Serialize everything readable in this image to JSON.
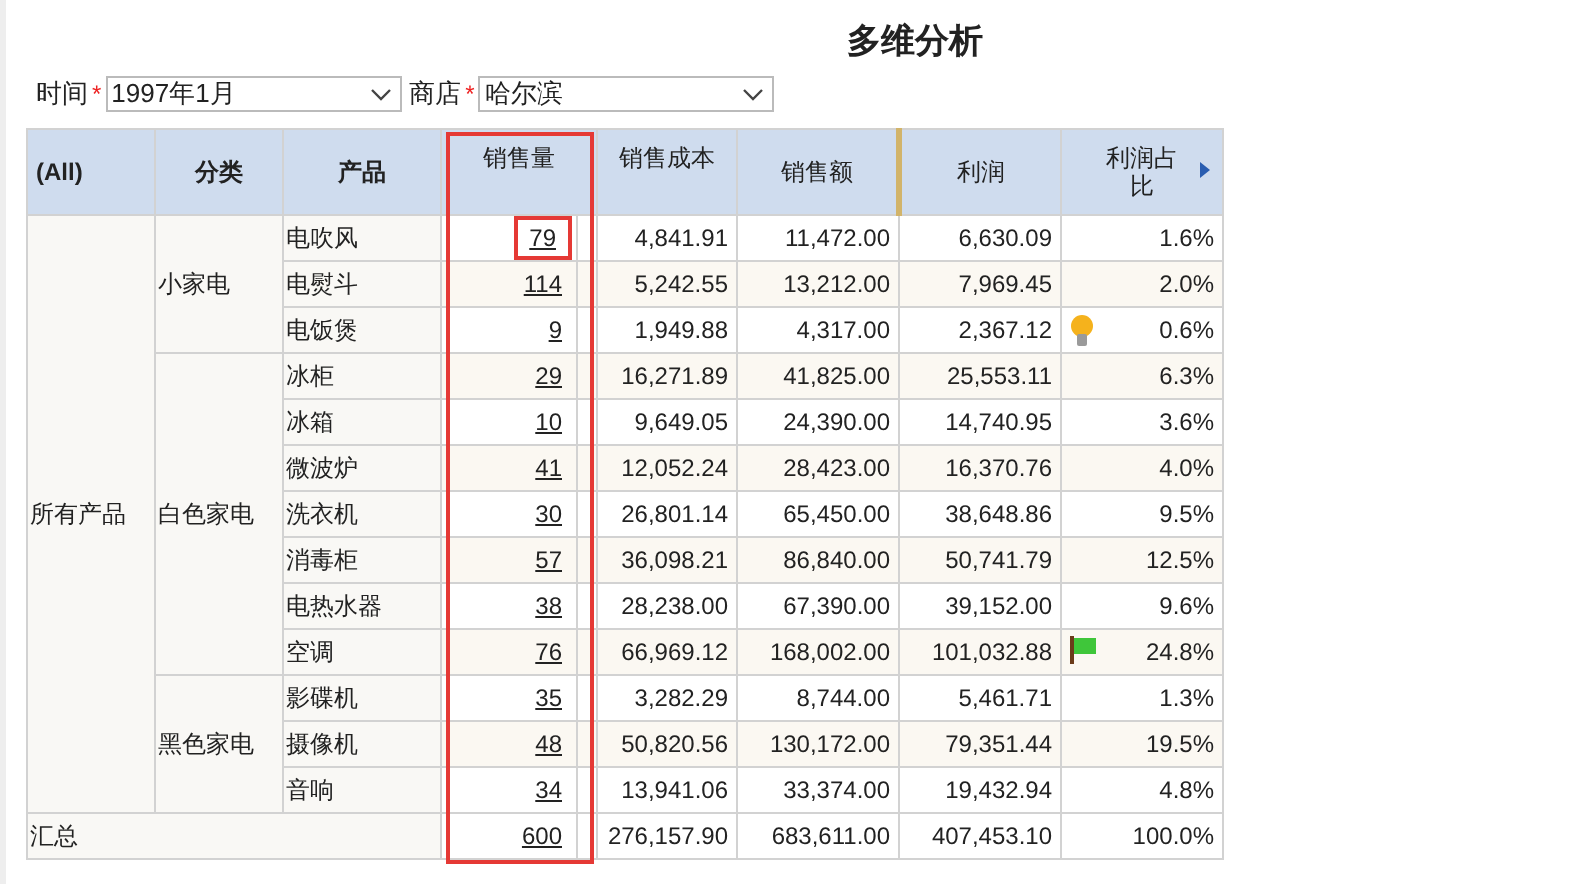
{
  "title": "多维分析",
  "filters": [
    {
      "label": "时间",
      "required_mark": "*",
      "value": "1997年1月"
    },
    {
      "label": "商店",
      "required_mark": "*",
      "value": "哈尔滨"
    }
  ],
  "table": {
    "columns": [
      {
        "label": "(All)",
        "highlighted": false
      },
      {
        "label": "分类",
        "highlighted": false
      },
      {
        "label": "产品",
        "highlighted": false
      },
      {
        "label": "销售量",
        "highlighted": true
      },
      {
        "label": "销售成本",
        "highlighted": false
      },
      {
        "label": "销售额",
        "highlighted": false
      },
      {
        "label": "利润",
        "highlighted": false
      },
      {
        "label": "利润占比",
        "highlighted": false
      }
    ],
    "root": {
      "label": "所有产品",
      "children": [
        {
          "label": "小家电",
          "children": [
            {
              "label": "电吹风",
              "kind": "plain",
              "highlighted": true,
              "values": [
                "79",
                "4,841.91",
                "11,472.00",
                "6,630.09",
                "1.6%"
              ]
            },
            {
              "label": "电熨斗",
              "kind": "plain",
              "highlighted": false,
              "values": [
                "114",
                "5,242.55",
                "13,212.00",
                "7,969.45",
                "2.0%"
              ]
            },
            {
              "label": "电饭煲",
              "kind": "bulb",
              "highlighted": false,
              "values": [
                "9",
                "1,949.88",
                "4,317.00",
                "2,367.12",
                "0.6%"
              ]
            }
          ]
        },
        {
          "label": "白色家电",
          "children": [
            {
              "label": "冰柜",
              "kind": "plain",
              "highlighted": false,
              "values": [
                "29",
                "16,271.89",
                "41,825.00",
                "25,553.11",
                "6.3%"
              ]
            },
            {
              "label": "冰箱",
              "kind": "plain",
              "highlighted": false,
              "values": [
                "10",
                "9,649.05",
                "24,390.00",
                "14,740.95",
                "3.6%"
              ]
            },
            {
              "label": "微波炉",
              "kind": "plain",
              "highlighted": false,
              "values": [
                "41",
                "12,052.24",
                "28,423.00",
                "16,370.76",
                "4.0%"
              ]
            },
            {
              "label": "洗衣机",
              "kind": "plain",
              "highlighted": false,
              "values": [
                "30",
                "26,801.14",
                "65,450.00",
                "38,648.86",
                "9.5%"
              ]
            },
            {
              "label": "消毒柜",
              "kind": "plain",
              "highlighted": false,
              "values": [
                "57",
                "36,098.21",
                "86,840.00",
                "50,741.79",
                "12.5%"
              ]
            },
            {
              "label": "电热水器",
              "kind": "plain",
              "highlighted": false,
              "values": [
                "38",
                "28,238.00",
                "67,390.00",
                "39,152.00",
                "9.6%"
              ]
            },
            {
              "label": "空调",
              "kind": "flag",
              "highlighted": false,
              "values": [
                "76",
                "66,969.12",
                "168,002.00",
                "101,032.88",
                "24.8%"
              ]
            }
          ]
        },
        {
          "label": "黑色家电",
          "children": [
            {
              "label": "影碟机",
              "kind": "plain",
              "highlighted": false,
              "values": [
                "35",
                "3,282.29",
                "8,744.00",
                "5,461.71",
                "1.3%"
              ]
            },
            {
              "label": "摄像机",
              "kind": "plain",
              "highlighted": false,
              "values": [
                "48",
                "50,820.56",
                "130,172.00",
                "79,351.44",
                "19.5%"
              ]
            },
            {
              "label": "音响",
              "kind": "plain",
              "highlighted": false,
              "values": [
                "34",
                "13,941.06",
                "33,374.00",
                "19,432.94",
                "4.8%"
              ]
            }
          ]
        }
      ]
    },
    "total": {
      "label": "汇总",
      "values": [
        "600",
        "276,157.90",
        "683,611.00",
        "407,453.10",
        "100.0%"
      ]
    }
  }
}
